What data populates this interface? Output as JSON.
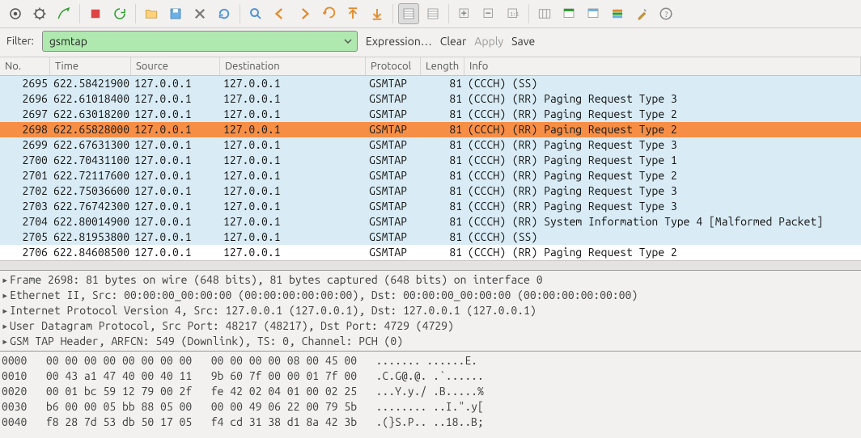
{
  "filter": {
    "label": "Filter:",
    "value": "gsmtap",
    "expression": "Expression…",
    "clear": "Clear",
    "apply": "Apply",
    "save": "Save"
  },
  "columns": {
    "no": "No.",
    "time": "Time",
    "source": "Source",
    "destination": "Destination",
    "protocol": "Protocol",
    "length": "Length",
    "info": "Info"
  },
  "col_widths": {
    "no": 62,
    "time": 100,
    "source": 110,
    "destination": 180,
    "protocol": 68,
    "length": 54,
    "info": 480
  },
  "selected_no": "2698",
  "packets": [
    {
      "no": "2695",
      "time": "622.58421900",
      "src": "127.0.0.1",
      "dst": "127.0.0.1",
      "proto": "GSMTAP",
      "len": "81",
      "info": "(CCCH) (SS)",
      "bg": "cyan"
    },
    {
      "no": "2696",
      "time": "622.61018400",
      "src": "127.0.0.1",
      "dst": "127.0.0.1",
      "proto": "GSMTAP",
      "len": "81",
      "info": "(CCCH) (RR) Paging Request Type 3",
      "bg": "cyan"
    },
    {
      "no": "2697",
      "time": "622.63018200",
      "src": "127.0.0.1",
      "dst": "127.0.0.1",
      "proto": "GSMTAP",
      "len": "81",
      "info": "(CCCH) (RR) Paging Request Type 2",
      "bg": "cyan"
    },
    {
      "no": "2698",
      "time": "622.65828000",
      "src": "127.0.0.1",
      "dst": "127.0.0.1",
      "proto": "GSMTAP",
      "len": "81",
      "info": "(CCCH) (RR) Paging Request Type 2",
      "bg": "selected"
    },
    {
      "no": "2699",
      "time": "622.67631300",
      "src": "127.0.0.1",
      "dst": "127.0.0.1",
      "proto": "GSMTAP",
      "len": "81",
      "info": "(CCCH) (RR) Paging Request Type 3",
      "bg": "cyan"
    },
    {
      "no": "2700",
      "time": "622.70431100",
      "src": "127.0.0.1",
      "dst": "127.0.0.1",
      "proto": "GSMTAP",
      "len": "81",
      "info": "(CCCH) (RR) Paging Request Type 1",
      "bg": "cyan"
    },
    {
      "no": "2701",
      "time": "622.72117600",
      "src": "127.0.0.1",
      "dst": "127.0.0.1",
      "proto": "GSMTAP",
      "len": "81",
      "info": "(CCCH) (RR) Paging Request Type 2",
      "bg": "cyan"
    },
    {
      "no": "2702",
      "time": "622.75036600",
      "src": "127.0.0.1",
      "dst": "127.0.0.1",
      "proto": "GSMTAP",
      "len": "81",
      "info": "(CCCH) (RR) Paging Request Type 3",
      "bg": "cyan"
    },
    {
      "no": "2703",
      "time": "622.76742300",
      "src": "127.0.0.1",
      "dst": "127.0.0.1",
      "proto": "GSMTAP",
      "len": "81",
      "info": "(CCCH) (RR) Paging Request Type 3",
      "bg": "cyan"
    },
    {
      "no": "2704",
      "time": "622.80014900",
      "src": "127.0.0.1",
      "dst": "127.0.0.1",
      "proto": "GSMTAP",
      "len": "81",
      "info": "(CCCH) (RR) System Information Type 4 [Malformed Packet]",
      "bg": "cyan"
    },
    {
      "no": "2705",
      "time": "622.81953800",
      "src": "127.0.0.1",
      "dst": "127.0.0.1",
      "proto": "GSMTAP",
      "len": "81",
      "info": "(CCCH) (SS)",
      "bg": "cyan"
    },
    {
      "no": "2706",
      "time": "622.84608500",
      "src": "127.0.0.1",
      "dst": "127.0.0.1",
      "proto": "GSMTAP",
      "len": "81",
      "info": "(CCCH) (RR) Paging Request Type 2",
      "bg": "white"
    }
  ],
  "details": [
    "Frame 2698: 81 bytes on wire (648 bits), 81 bytes captured (648 bits) on interface 0",
    "Ethernet II, Src: 00:00:00_00:00:00 (00:00:00:00:00:00), Dst: 00:00:00_00:00:00 (00:00:00:00:00:00)",
    "Internet Protocol Version 4, Src: 127.0.0.1 (127.0.0.1), Dst: 127.0.0.1 (127.0.0.1)",
    "User Datagram Protocol, Src Port: 48217 (48217), Dst Port: 4729 (4729)",
    "GSM TAP Header, ARFCN: 549 (Downlink), TS: 0, Channel: PCH (0)"
  ],
  "hex": [
    {
      "off": "0000",
      "hex": "00 00 00 00 00 00 00 00   00 00 00 00 08 00 45 00",
      "asc": "   ....... ......E."
    },
    {
      "off": "0010",
      "hex": "00 43 a1 47 40 00 40 11   9b 60 7f 00 00 01 7f 00",
      "asc": "   .C.G@.@. .`......"
    },
    {
      "off": "0020",
      "hex": "00 01 bc 59 12 79 00 2f   fe 42 02 04 01 00 02 25",
      "asc": "   ...Y.y./ .B.....%"
    },
    {
      "off": "0030",
      "hex": "b6 00 00 05 bb 88 05 00   00 00 49 06 22 00 79 5b",
      "asc": "   ........ ..I.\".y["
    },
    {
      "off": "0040",
      "hex": "f8 28 7d 53 db 50 17 05   f4 cd 31 38 d1 8a 42 3b",
      "asc": "   .(}S.P.. ..18..B;"
    }
  ],
  "icons": {
    "toolbar": [
      "interfaces-icon",
      "options-icon",
      "start-capture-icon",
      "stop-capture-icon",
      "restart-capture-icon",
      "open-file-icon",
      "save-file-icon",
      "close-icon",
      "reload-icon",
      "find-icon",
      "go-back-icon",
      "go-forward-icon",
      "jump-back-icon",
      "go-first-icon",
      "go-last-icon",
      "colorize-icon",
      "auto-scroll-icon",
      "zoom-in-icon",
      "zoom-out-icon",
      "zoom-reset-icon",
      "resize-columns-icon",
      "capture-filters-icon",
      "display-filters-icon",
      "coloring-rules-icon",
      "preferences-icon",
      "help-icon"
    ]
  }
}
